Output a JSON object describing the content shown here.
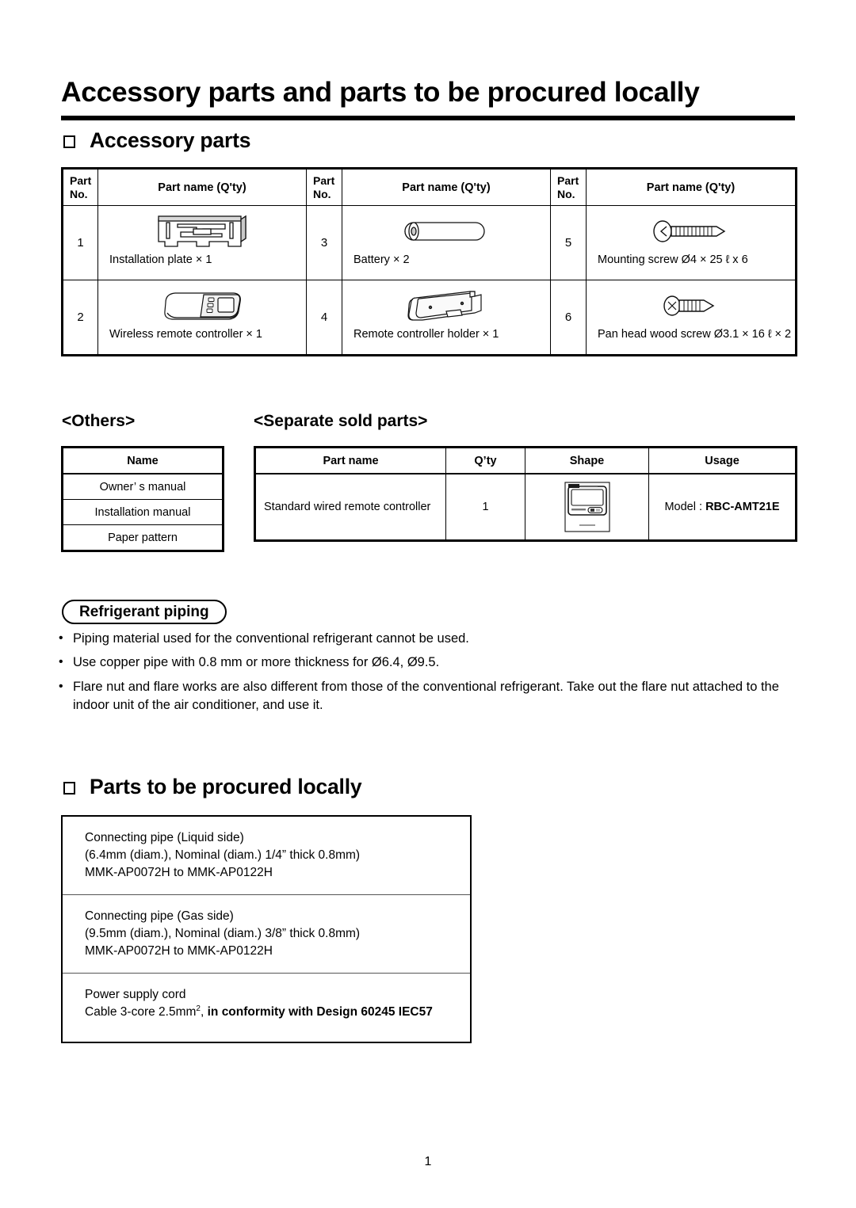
{
  "document": {
    "title": "Accessory parts and parts to be procured locally",
    "page_number": "1"
  },
  "accessory_section": {
    "heading": "Accessory parts",
    "headers": {
      "part_no": "Part\nNo.",
      "part_no_line1": "Part",
      "part_no_line2": "No.",
      "part_name": "Part name (Q'ty)"
    },
    "items": [
      {
        "no": "1",
        "name": "Installation plate × 1",
        "icon": "installation-plate-icon"
      },
      {
        "no": "3",
        "name": "Battery × 2",
        "icon": "battery-icon"
      },
      {
        "no": "5",
        "name": "Mounting screw Ø4 × 25 ℓ x 6",
        "icon": "mounting-screw-icon"
      },
      {
        "no": "2",
        "name": "Wireless remote controller × 1",
        "icon": "wireless-remote-controller-icon"
      },
      {
        "no": "4",
        "name": "Remote controller holder × 1",
        "icon": "remote-controller-holder-icon"
      },
      {
        "no": "6",
        "name": "Pan head wood screw Ø3.1 × 16 ℓ × 2",
        "icon": "pan-head-wood-screw-icon"
      }
    ]
  },
  "others_section": {
    "label": "<Others>",
    "header": "Name",
    "rows": [
      "Owner’ s manual",
      "Installation manual",
      "Paper pattern"
    ]
  },
  "separate_section": {
    "label": "<Separate sold parts>",
    "headers": [
      "Part name",
      "Q’ty",
      "Shape",
      "Usage"
    ],
    "row": {
      "part_name": "Standard wired remote controller",
      "qty": "1",
      "shape_icon": "wired-remote-controller-icon",
      "usage_prefix": "Model : ",
      "usage_model": "RBC-AMT21E"
    }
  },
  "refrigerant_section": {
    "badge": "Refrigerant piping",
    "bullet_char": "•",
    "bullets": [
      "Piping material used for the conventional refrigerant cannot be used.",
      "Use copper pipe with 0.8 mm or more thickness for Ø6.4, Ø9.5.",
      "Flare nut and flare works are also different from those of the conventional refrigerant.  Take out the flare nut attached to the indoor unit of the air conditioner, and use it."
    ]
  },
  "procured_section": {
    "heading": "Parts to be procured locally",
    "rows": [
      {
        "line1": "Connecting pipe (Liquid side)",
        "line2": "(6.4mm (diam.), Nominal (diam.) 1/4” thick 0.8mm)",
        "line3": "MMK-AP0072H to MMK-AP0122H"
      },
      {
        "line1": "Connecting pipe (Gas side)",
        "line2": "(9.5mm (diam.), Nominal (diam.) 3/8” thick 0.8mm)",
        "line3": "MMK-AP0072H to MMK-AP0122H"
      },
      {
        "line1": "Power supply cord",
        "cable_prefix": "Cable 3-core 2.5mm",
        "cable_sup": "2",
        "cable_mid": ", ",
        "cable_bold": "in conformity with Design 60245 IEC57"
      }
    ]
  },
  "colors": {
    "ink": "#000000",
    "paper": "#ffffff",
    "rule_gray": "#555555"
  }
}
